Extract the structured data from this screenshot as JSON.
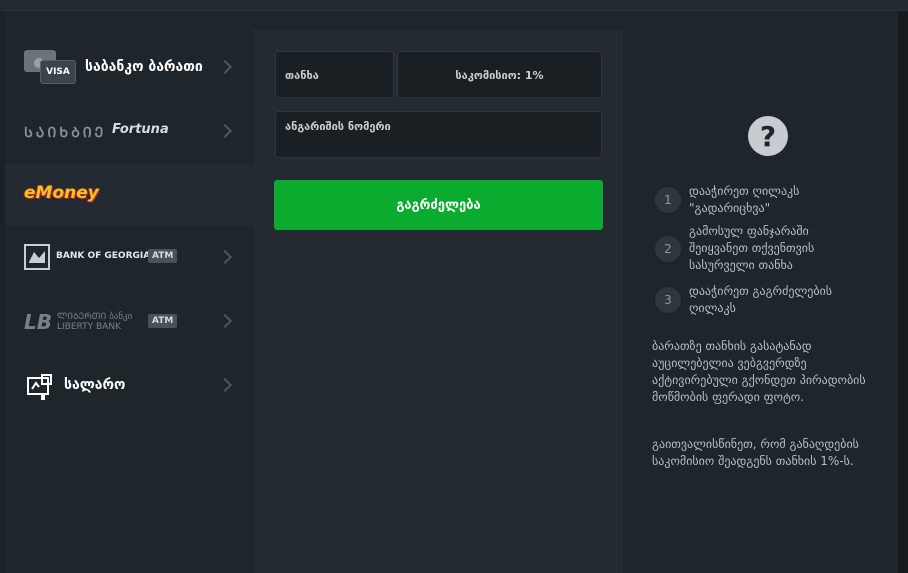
{
  "sidebar": {
    "items": [
      {
        "label": "საბანკო ბარათი",
        "card_badge": "VISA"
      },
      {
        "logo_text": "ᲡᲐᲘᲮᲑᲘᲔ",
        "logo_script": "Fortuna"
      },
      {
        "logo_text": "eMoney"
      },
      {
        "label": "BANK OF GEORGIA",
        "badge": "ATM"
      },
      {
        "label_top": "ᲚᲘᲑᲔᲠᲗᲘ ბანკი",
        "label_bottom": "LIBERTY BANK",
        "badge": "ATM"
      },
      {
        "label": "სალარო"
      }
    ]
  },
  "form": {
    "amount_label": "თანხა",
    "commission_label": "საკომისიო: 1%",
    "account_label": "ანგარიშის ნომერი",
    "continue_label": "გაგრძელება"
  },
  "info": {
    "qmark": "?",
    "steps": [
      {
        "num": "1",
        "text": "დააჭირეთ ღილაკს \"გადარიცხვა\""
      },
      {
        "num": "2",
        "text": "გამოსულ ფანჯარაში შეიყვანეთ თქვენთვის სასურველი თანხა"
      },
      {
        "num": "3",
        "text": "დააჭირეთ გაგრძელების ღილაკს"
      }
    ],
    "para1": "ბარათზე თანხის გასატანად აუცილებელია ვებგვერდზე აქტივირებული გქონდეთ პირადობის მოწმობის ფერადი ფოტო.",
    "para2": "გაითვალისწინეთ, რომ განაღდების საკომისიო შეადგენს თანხის 1%-ს."
  }
}
